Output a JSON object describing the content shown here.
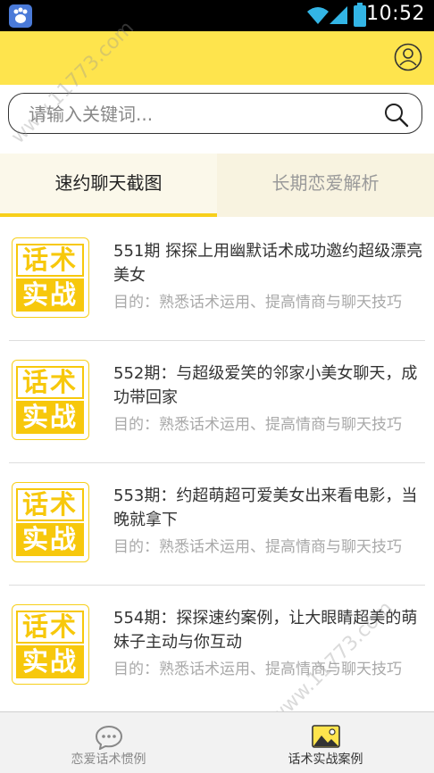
{
  "status_bar": {
    "time": "10:52"
  },
  "search": {
    "placeholder": "请输入关键词..."
  },
  "tabs": [
    {
      "label": "速约聊天截图",
      "active": true
    },
    {
      "label": "长期恋爱解析",
      "active": false
    }
  ],
  "thumb": {
    "top": "话术",
    "bottom": "实战"
  },
  "items": [
    {
      "title": "551期 探探上用幽默话术成功邀约超级漂亮美女",
      "desc": "目的：熟悉话术运用、提高情商与聊天技巧"
    },
    {
      "title": "552期：与超级爱笑的邻家小美女聊天，成功带回家",
      "desc": "目的：熟悉话术运用、提高情商与聊天技巧"
    },
    {
      "title": "553期：约超萌超可爱美女出来看电影，当晚就拿下",
      "desc": "目的：熟悉话术运用、提高情商与聊天技巧"
    },
    {
      "title": "554期：探探速约案例，让大眼睛超美的萌妹子主动与你互动",
      "desc": "目的：熟悉话术运用、提高情商与聊天技巧"
    }
  ],
  "bottom_nav": [
    {
      "label": "恋爱话术惯例",
      "icon": "chat-bubble-icon",
      "active": false
    },
    {
      "label": "话术实战案例",
      "icon": "image-icon",
      "active": true
    }
  ],
  "watermark": "www.11773.com",
  "colors": {
    "accent": "#fee44d",
    "tab_indicator": "#f7cf1a",
    "thumb": "#f7c80c"
  }
}
